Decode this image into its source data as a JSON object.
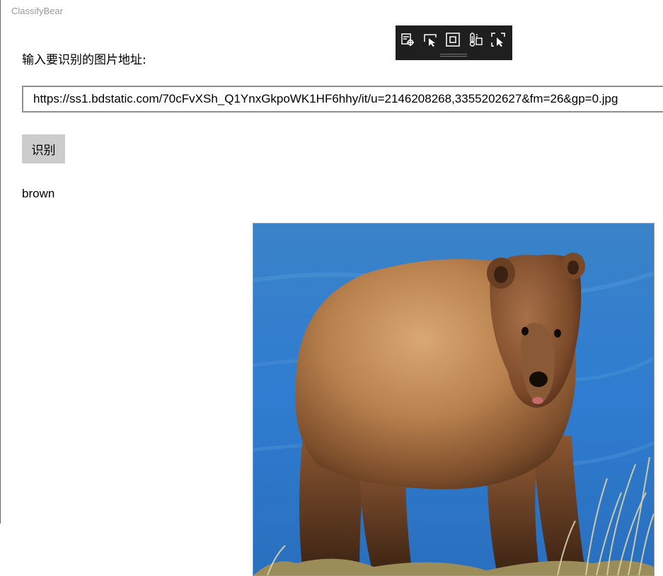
{
  "window": {
    "title": "ClassifyBear"
  },
  "form": {
    "prompt_label": "输入要识别的图片地址:",
    "url_value": "https://ss1.bdstatic.com/70cFvXSh_Q1YnxGkpoWK1HF6hhy/it/u=2146208268,3355202627&fm=26&gp=0.jpg",
    "recognize_button_label": "识别"
  },
  "result": {
    "label": "brown"
  },
  "debug_toolbar": {
    "buttons": [
      {
        "icon": "live-visual-tree-icon"
      },
      {
        "icon": "select-element-icon"
      },
      {
        "icon": "display-layout-adorners-icon"
      },
      {
        "icon": "track-focus-icon"
      },
      {
        "icon": "preview-selection-icon"
      }
    ]
  },
  "image": {
    "subject": "bear-photo-icon"
  }
}
